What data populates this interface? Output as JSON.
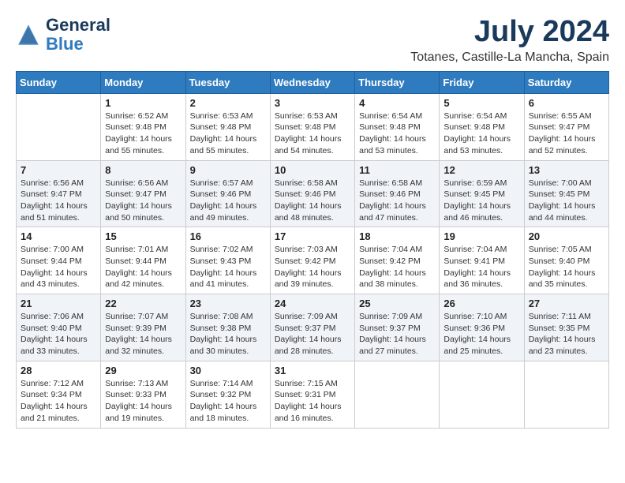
{
  "logo": {
    "line1": "General",
    "line2": "Blue"
  },
  "title": "July 2024",
  "subtitle": "Totanes, Castille-La Mancha, Spain",
  "days_of_week": [
    "Sunday",
    "Monday",
    "Tuesday",
    "Wednesday",
    "Thursday",
    "Friday",
    "Saturday"
  ],
  "weeks": [
    [
      {
        "day": "",
        "info": ""
      },
      {
        "day": "1",
        "info": "Sunrise: 6:52 AM\nSunset: 9:48 PM\nDaylight: 14 hours\nand 55 minutes."
      },
      {
        "day": "2",
        "info": "Sunrise: 6:53 AM\nSunset: 9:48 PM\nDaylight: 14 hours\nand 55 minutes."
      },
      {
        "day": "3",
        "info": "Sunrise: 6:53 AM\nSunset: 9:48 PM\nDaylight: 14 hours\nand 54 minutes."
      },
      {
        "day": "4",
        "info": "Sunrise: 6:54 AM\nSunset: 9:48 PM\nDaylight: 14 hours\nand 53 minutes."
      },
      {
        "day": "5",
        "info": "Sunrise: 6:54 AM\nSunset: 9:48 PM\nDaylight: 14 hours\nand 53 minutes."
      },
      {
        "day": "6",
        "info": "Sunrise: 6:55 AM\nSunset: 9:47 PM\nDaylight: 14 hours\nand 52 minutes."
      }
    ],
    [
      {
        "day": "7",
        "info": "Sunrise: 6:56 AM\nSunset: 9:47 PM\nDaylight: 14 hours\nand 51 minutes."
      },
      {
        "day": "8",
        "info": "Sunrise: 6:56 AM\nSunset: 9:47 PM\nDaylight: 14 hours\nand 50 minutes."
      },
      {
        "day": "9",
        "info": "Sunrise: 6:57 AM\nSunset: 9:46 PM\nDaylight: 14 hours\nand 49 minutes."
      },
      {
        "day": "10",
        "info": "Sunrise: 6:58 AM\nSunset: 9:46 PM\nDaylight: 14 hours\nand 48 minutes."
      },
      {
        "day": "11",
        "info": "Sunrise: 6:58 AM\nSunset: 9:46 PM\nDaylight: 14 hours\nand 47 minutes."
      },
      {
        "day": "12",
        "info": "Sunrise: 6:59 AM\nSunset: 9:45 PM\nDaylight: 14 hours\nand 46 minutes."
      },
      {
        "day": "13",
        "info": "Sunrise: 7:00 AM\nSunset: 9:45 PM\nDaylight: 14 hours\nand 44 minutes."
      }
    ],
    [
      {
        "day": "14",
        "info": "Sunrise: 7:00 AM\nSunset: 9:44 PM\nDaylight: 14 hours\nand 43 minutes."
      },
      {
        "day": "15",
        "info": "Sunrise: 7:01 AM\nSunset: 9:44 PM\nDaylight: 14 hours\nand 42 minutes."
      },
      {
        "day": "16",
        "info": "Sunrise: 7:02 AM\nSunset: 9:43 PM\nDaylight: 14 hours\nand 41 minutes."
      },
      {
        "day": "17",
        "info": "Sunrise: 7:03 AM\nSunset: 9:42 PM\nDaylight: 14 hours\nand 39 minutes."
      },
      {
        "day": "18",
        "info": "Sunrise: 7:04 AM\nSunset: 9:42 PM\nDaylight: 14 hours\nand 38 minutes."
      },
      {
        "day": "19",
        "info": "Sunrise: 7:04 AM\nSunset: 9:41 PM\nDaylight: 14 hours\nand 36 minutes."
      },
      {
        "day": "20",
        "info": "Sunrise: 7:05 AM\nSunset: 9:40 PM\nDaylight: 14 hours\nand 35 minutes."
      }
    ],
    [
      {
        "day": "21",
        "info": "Sunrise: 7:06 AM\nSunset: 9:40 PM\nDaylight: 14 hours\nand 33 minutes."
      },
      {
        "day": "22",
        "info": "Sunrise: 7:07 AM\nSunset: 9:39 PM\nDaylight: 14 hours\nand 32 minutes."
      },
      {
        "day": "23",
        "info": "Sunrise: 7:08 AM\nSunset: 9:38 PM\nDaylight: 14 hours\nand 30 minutes."
      },
      {
        "day": "24",
        "info": "Sunrise: 7:09 AM\nSunset: 9:37 PM\nDaylight: 14 hours\nand 28 minutes."
      },
      {
        "day": "25",
        "info": "Sunrise: 7:09 AM\nSunset: 9:37 PM\nDaylight: 14 hours\nand 27 minutes."
      },
      {
        "day": "26",
        "info": "Sunrise: 7:10 AM\nSunset: 9:36 PM\nDaylight: 14 hours\nand 25 minutes."
      },
      {
        "day": "27",
        "info": "Sunrise: 7:11 AM\nSunset: 9:35 PM\nDaylight: 14 hours\nand 23 minutes."
      }
    ],
    [
      {
        "day": "28",
        "info": "Sunrise: 7:12 AM\nSunset: 9:34 PM\nDaylight: 14 hours\nand 21 minutes."
      },
      {
        "day": "29",
        "info": "Sunrise: 7:13 AM\nSunset: 9:33 PM\nDaylight: 14 hours\nand 19 minutes."
      },
      {
        "day": "30",
        "info": "Sunrise: 7:14 AM\nSunset: 9:32 PM\nDaylight: 14 hours\nand 18 minutes."
      },
      {
        "day": "31",
        "info": "Sunrise: 7:15 AM\nSunset: 9:31 PM\nDaylight: 14 hours\nand 16 minutes."
      },
      {
        "day": "",
        "info": ""
      },
      {
        "day": "",
        "info": ""
      },
      {
        "day": "",
        "info": ""
      }
    ]
  ]
}
